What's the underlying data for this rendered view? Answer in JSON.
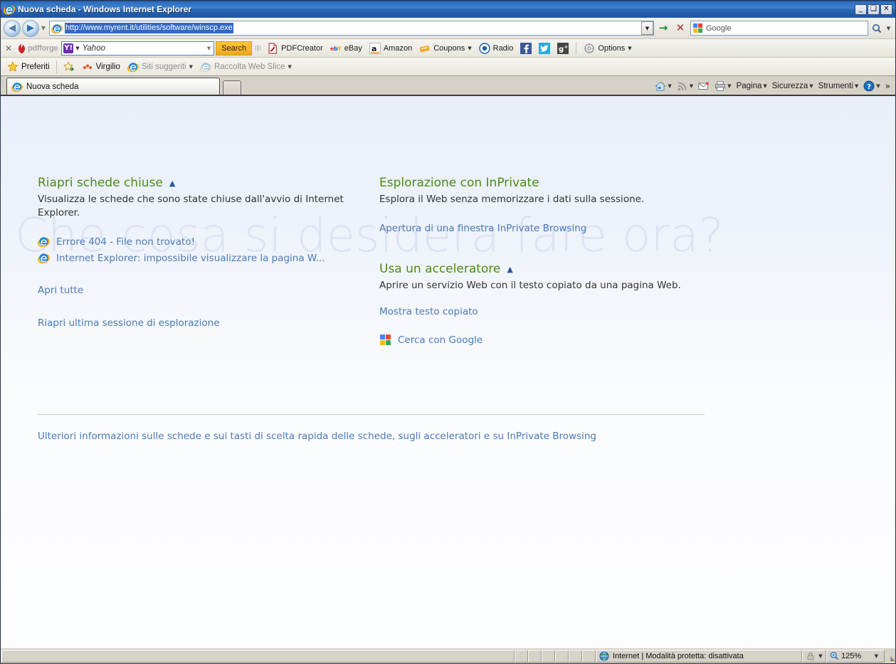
{
  "window": {
    "title": "Nuova scheda - Windows Internet Explorer",
    "minimize_label": "_",
    "maximize_label": "❑",
    "close_label": "✕"
  },
  "address_bar": {
    "back_label": "◀",
    "forward_label": "▶",
    "history_caret": "▼",
    "url": "http://www.myrent.it/utilities/software/winscp.exe",
    "url_dropdown_caret": "▼",
    "go_label": "→",
    "stop_label": "✕",
    "search_placeholder": "Google",
    "search_go_label": "ὐd",
    "search_caret": "▼"
  },
  "addon_toolbar": {
    "close_label": "✕",
    "brand": "pdfforge",
    "yahoo": {
      "logo": "Y!",
      "caret": "▼",
      "placeholder": "Yahoo",
      "dropdown": "▼"
    },
    "search_button": "Search",
    "items": [
      {
        "label": "PDFCreator",
        "icon": "pdf-icon",
        "caret": ""
      },
      {
        "label": "eBay",
        "icon": "ebay-icon",
        "caret": ""
      },
      {
        "label": "Amazon",
        "icon": "amazon-icon",
        "caret": ""
      },
      {
        "label": "Coupons",
        "icon": "coupons-icon",
        "caret": "▼"
      },
      {
        "label": "Radio",
        "icon": "radio-icon",
        "caret": ""
      }
    ],
    "social": [
      {
        "name": "facebook-icon",
        "label": "f"
      },
      {
        "name": "twitter-icon",
        "label": "t"
      },
      {
        "name": "google-plus-icon",
        "label": "g+"
      }
    ],
    "options": {
      "label": "Options",
      "caret": "▼"
    }
  },
  "favorites_bar": {
    "favorites_label": "Preferiti",
    "items": [
      {
        "label": "Virgilio",
        "icon": "virgilio-icon",
        "caret": "",
        "dim": false
      },
      {
        "label": "Siti suggeriti",
        "icon": "ie-icon",
        "caret": "▼",
        "dim": true
      },
      {
        "label": "Raccolta Web Slice",
        "icon": "ie-icon",
        "caret": "▼",
        "dim": true
      }
    ]
  },
  "tabs": {
    "items": [
      {
        "label": "Nuova scheda",
        "icon": "ie-icon"
      }
    ],
    "new_tab_label": ""
  },
  "command_bar": {
    "items": [
      {
        "name": "home-icon",
        "label": "",
        "caret": "▼"
      },
      {
        "name": "feeds-icon",
        "label": "",
        "caret": "▼"
      },
      {
        "name": "mail-icon",
        "label": "",
        "caret": ""
      },
      {
        "name": "print-icon",
        "label": "",
        "caret": "▼"
      },
      {
        "name": "page-menu",
        "label": "Pagina",
        "caret": "▼"
      },
      {
        "name": "security-menu",
        "label": "Sicurezza",
        "caret": "▼"
      },
      {
        "name": "tools-menu",
        "label": "Strumenti",
        "caret": "▼"
      },
      {
        "name": "help-menu",
        "label": "",
        "caret": "▼"
      }
    ],
    "overflow_label": "»"
  },
  "page": {
    "watermark": "Che cosa si desidera fare ora?",
    "left_column": {
      "section_title": "Riapri schede chiuse",
      "collapse_caret": "▲",
      "description": "Visualizza le schede che sono state chiuse dall'avvio di Internet Explorer.",
      "closed_tabs": [
        {
          "label": "Errore 404 - File non trovato!",
          "icon": "ie-icon"
        },
        {
          "label": "Internet Explorer: impossibile visualizzare la pagina W...",
          "icon": "ie-icon"
        }
      ],
      "open_all_label": "Apri tutte",
      "reopen_session_label": "Riapri ultima sessione di esplorazione"
    },
    "right_column": {
      "inprivate": {
        "section_title": "Esplorazione con InPrivate",
        "description": "Esplora il Web senza memorizzare i dati sulla sessione.",
        "link": "Apertura di una finestra InPrivate Browsing"
      },
      "accelerator": {
        "section_title": "Usa un accelerato",
        "section_title_full": "Usa un acceleratore",
        "collapse_caret": "▲",
        "description": "Aprire un servizio Web con il testo copiato da una pagina Web.",
        "show_text_link": "Mostra testo copiato",
        "service": {
          "label": "Cerca con Google",
          "icon": "google-icon"
        }
      }
    },
    "footer_link": "Ulteriori informazioni sulle schede e sui tasti di scelta rapida delle schede, sugli acceleratori e su InPrivate Browsing"
  },
  "status_bar": {
    "zone_text": "Internet | Modalità protetta: disattivata",
    "zone_icon": "globe-icon",
    "lock_icon": "lock-icon",
    "lock_caret": "▼",
    "zoom_icon": "zoom-icon",
    "zoom_level": "125%",
    "zoom_caret": "▼"
  },
  "colors": {
    "title_bar_blue": "#2f6dbd",
    "green_heading": "#4c8a12",
    "link_blue": "#4a7ab5",
    "watermark_blue": "#dce3f2",
    "search_button_orange": "#f0a81e"
  }
}
